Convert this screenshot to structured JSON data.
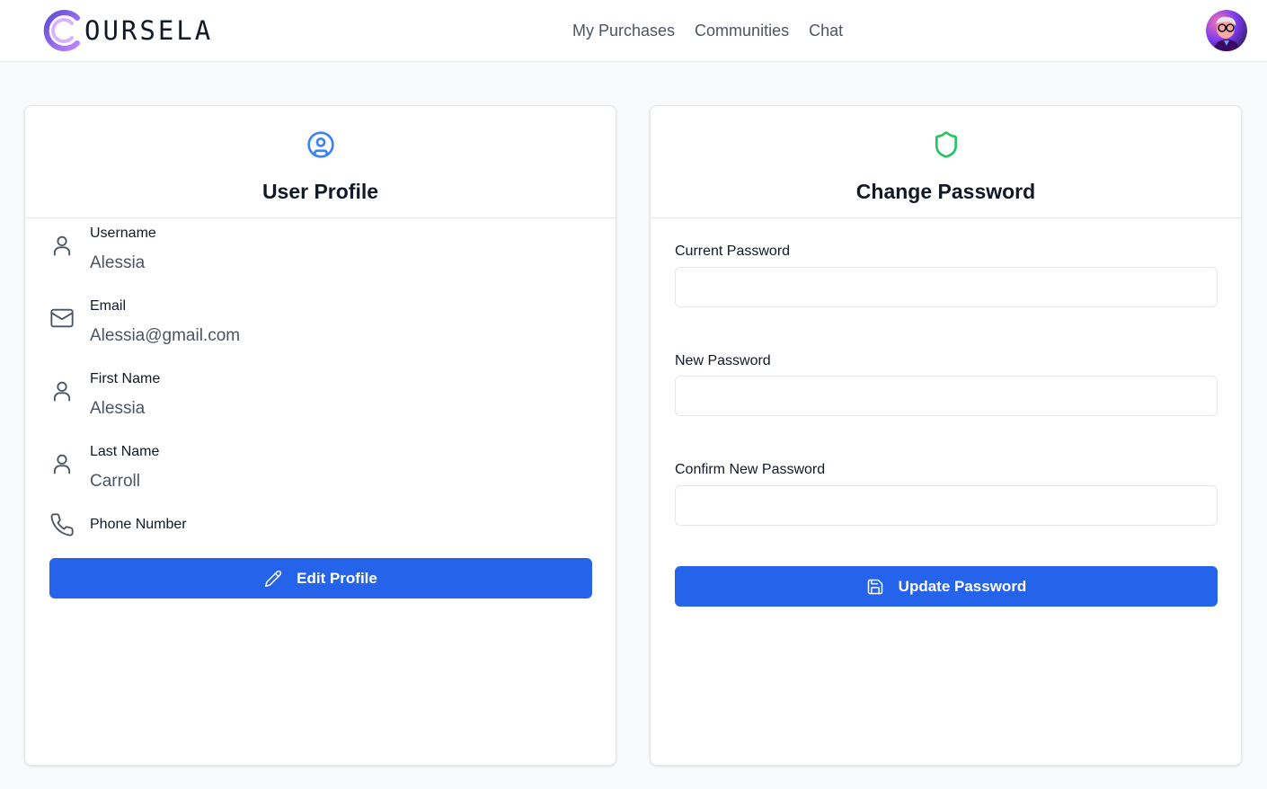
{
  "header": {
    "brand_text": "OURSELA",
    "brand_letter": "C",
    "nav": [
      {
        "label": "My Purchases"
      },
      {
        "label": "Communities"
      },
      {
        "label": "Chat"
      }
    ],
    "avatar_icon": "user-avatar"
  },
  "profile": {
    "title": "User Profile",
    "icon": "user-circle-icon",
    "fields": [
      {
        "label": "Username",
        "value": "Alessia",
        "icon": "user-icon"
      },
      {
        "label": "Email",
        "value": "Alessia@gmail.com",
        "icon": "mail-icon"
      },
      {
        "label": "First Name",
        "value": "Alessia",
        "icon": "user-icon"
      },
      {
        "label": "Last Name",
        "value": "Carroll",
        "icon": "user-icon"
      },
      {
        "label": "Phone Number",
        "value": "",
        "icon": "phone-icon"
      }
    ],
    "edit_button": "Edit Profile"
  },
  "password": {
    "title": "Change Password",
    "icon": "shield-icon",
    "current_label": "Current Password",
    "current_value": "",
    "new_label": "New Password",
    "new_value": "",
    "confirm_label": "Confirm New Password",
    "confirm_value": "",
    "update_button": "Update Password"
  },
  "colors": {
    "primary": "#2563eb",
    "profile_icon": "#3b82f6",
    "shield_icon": "#22c55e",
    "logo_purple": "#7c5cc4"
  }
}
